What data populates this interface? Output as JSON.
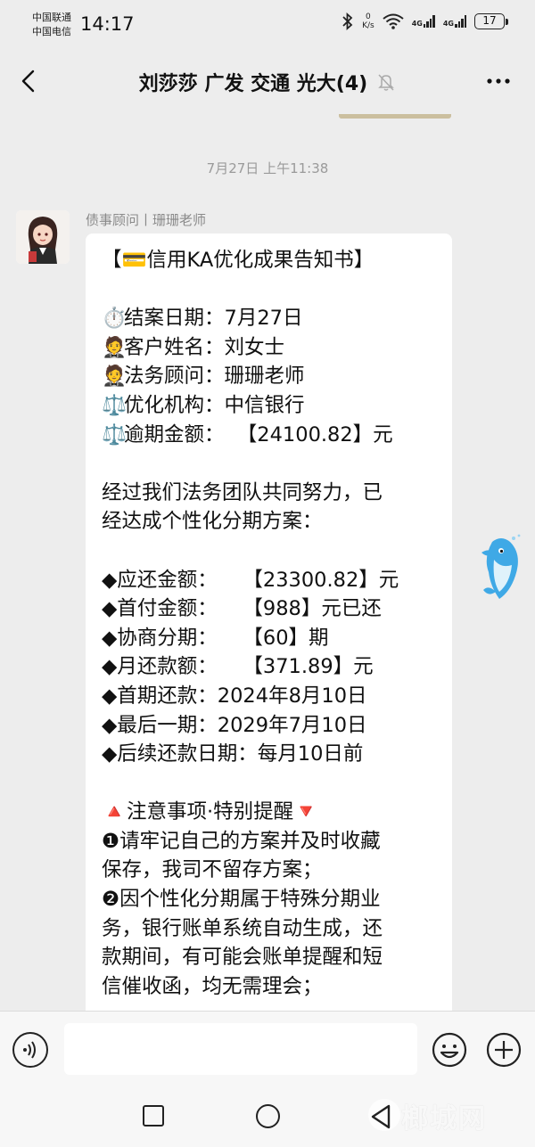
{
  "status_bar": {
    "carrier_1": "中国联通",
    "carrier_2": "中国电信",
    "time": "14:17",
    "net_speed_value": "0",
    "net_speed_unit": "K/s",
    "network_1": "4G",
    "network_2": "4G",
    "battery": "17"
  },
  "header": {
    "title": "刘莎莎 广发 交通 光大(4)",
    "muted": true
  },
  "chat": {
    "timestamp": "7月27日 上午11:38",
    "message": {
      "sender": "债事顾问丨珊珊老师",
      "lines": [
        {
          "text": "【💳信用KA优化成果告知书】"
        },
        {
          "text": ""
        },
        {
          "emoji": "⏱️",
          "text": "结案日期：7月27日"
        },
        {
          "emoji": "🤵",
          "text": "客户姓名：刘女士"
        },
        {
          "emoji": "🤵",
          "text": "法务顾问：珊珊老师"
        },
        {
          "emoji": "⚖️",
          "text": "优化机构：中信银行"
        },
        {
          "emoji": "⚖️",
          "text": "逾期金额：  【24100.82】元"
        },
        {
          "text": ""
        },
        {
          "text": "经过我们法务团队共同努力，已"
        },
        {
          "text": "经达成个性化分期方案："
        },
        {
          "text": ""
        },
        {
          "text": "◆应还金额：    【23300.82】元"
        },
        {
          "text": "◆首付金额：    【988】元已还"
        },
        {
          "text": "◆协商分期：    【60】期"
        },
        {
          "text": "◆月还款额：    【371.89】元"
        },
        {
          "text": "◆首期还款：2024年8月10日"
        },
        {
          "text": "◆最后一期：2029年7月10日"
        },
        {
          "text": "◆后续还款日期：每月10日前"
        },
        {
          "text": ""
        },
        {
          "text": "🔺注意事项·特别提醒🔻"
        },
        {
          "text": "❶请牢记自己的方案并及时收藏"
        },
        {
          "text": "保存，我司不留存方案；"
        },
        {
          "text": "❷因个性化分期属于特殊分期业"
        },
        {
          "text": "务，银行账单系统自动生成，还"
        },
        {
          "text": "款期间，有可能会账单提醒和短"
        },
        {
          "text": "信催收函，均无需理会；"
        }
      ]
    }
  },
  "input_bar": {
    "text_value": ""
  },
  "watermark": "榔城网",
  "colors": {
    "background": "#ededed",
    "bubble": "#ffffff",
    "timestamp": "#9a9a9a",
    "pull_tab": "#cbbf9f"
  }
}
